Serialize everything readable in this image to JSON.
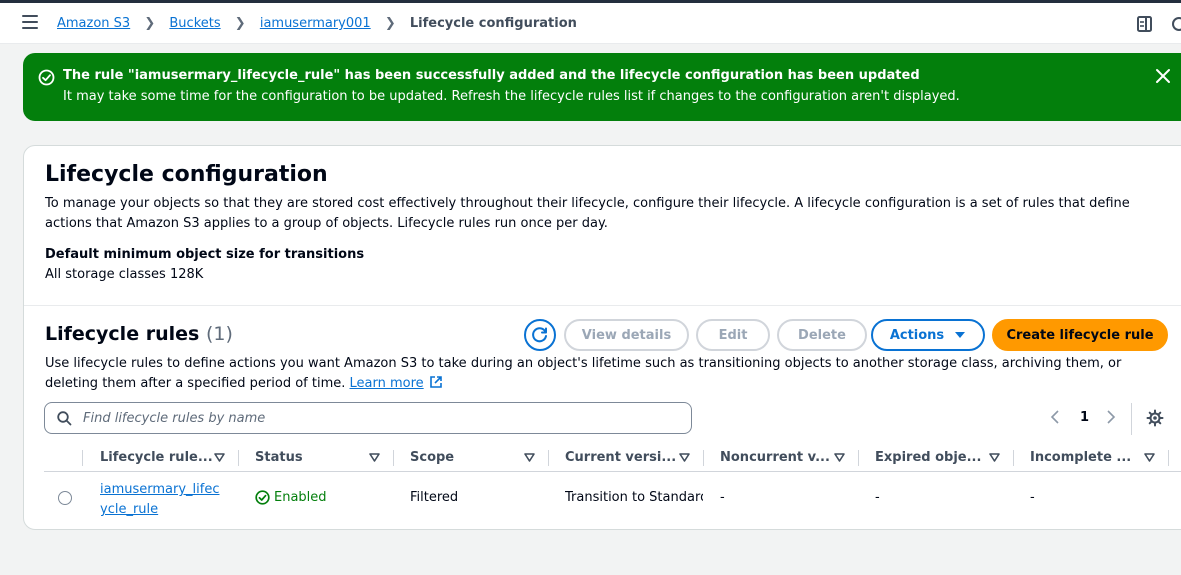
{
  "breadcrumb": {
    "items": [
      "Amazon S3",
      "Buckets",
      "iamusermary001"
    ],
    "current": "Lifecycle configuration"
  },
  "flash": {
    "title": "The rule \"iamusermary_lifecycle_rule\" has been successfully added and the lifecycle configuration has been updated",
    "message": "It may take some time for the configuration to be updated. Refresh the lifecycle rules list if changes to the configuration aren't displayed."
  },
  "config": {
    "title": "Lifecycle configuration",
    "description": "To manage your objects so that they are stored cost effectively throughout their lifecycle, configure their lifecycle. A lifecycle configuration is a set of rules that define actions that Amazon S3 applies to a group of objects. Lifecycle rules run once per day.",
    "min_size_label": "Default minimum object size for transitions",
    "min_size_value": "All storage classes 128K"
  },
  "rules": {
    "title": "Lifecycle rules",
    "count": "(1)",
    "buttons": {
      "view_details": "View details",
      "edit": "Edit",
      "delete": "Delete",
      "actions": "Actions",
      "create": "Create lifecycle rule"
    },
    "description": "Use lifecycle rules to define actions you want Amazon S3 to take during an object's lifetime such as transitioning objects to another storage class, archiving them, or deleting them after a specified period of time.",
    "learn_more": "Learn more",
    "search_placeholder": "Find lifecycle rules by name",
    "page": "1",
    "columns": [
      "Lifecycle rule...",
      "Status",
      "Scope",
      "Current versi...",
      "Noncurrent v...",
      "Expired obje...",
      "Incomplete ..."
    ],
    "rows": [
      {
        "name": "iamusermary_lifecycle_rule",
        "status": "Enabled",
        "scope": "Filtered",
        "current_versions": "Transition to Standard",
        "noncurrent_versions": "-",
        "expired_object": "-",
        "incomplete": "-"
      }
    ]
  },
  "colors": {
    "success": "#037f0c",
    "link": "#0972d3",
    "primary": "#ff9900"
  }
}
